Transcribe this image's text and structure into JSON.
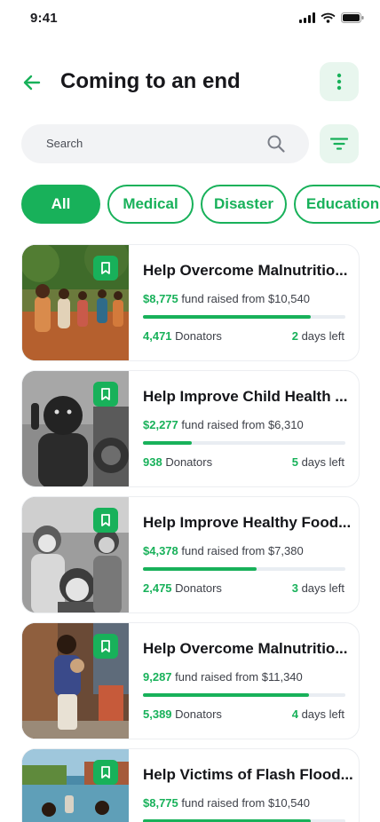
{
  "status": {
    "time": "9:41"
  },
  "header": {
    "title": "Coming to an end"
  },
  "search": {
    "placeholder": "Search"
  },
  "filters": [
    {
      "label": "All",
      "active": true
    },
    {
      "label": "Medical",
      "active": false
    },
    {
      "label": "Disaster",
      "active": false
    },
    {
      "label": "Education",
      "active": false
    }
  ],
  "campaigns": [
    {
      "title": "Help Overcome Malnutritio...",
      "raised": "$8,775",
      "raised_text": "fund raised from",
      "goal": "$10,540",
      "progress": 0.83,
      "donators": "4,471",
      "donators_label": "Donators",
      "days": "2",
      "days_label": "days left"
    },
    {
      "title": "Help Improve Child Health ...",
      "raised": "$2,277",
      "raised_text": "fund raised from",
      "goal": "$6,310",
      "progress": 0.24,
      "donators": "938",
      "donators_label": "Donators",
      "days": "5",
      "days_label": "days left"
    },
    {
      "title": "Help Improve Healthy Food...",
      "raised": "$4,378",
      "raised_text": "fund raised from",
      "goal": "$7,380",
      "progress": 0.56,
      "donators": "2,475",
      "donators_label": "Donators",
      "days": "3",
      "days_label": "days left"
    },
    {
      "title": "Help Overcome Malnutritio...",
      "raised": "9,287",
      "raised_text": "fund raised from",
      "goal": "$11,340",
      "progress": 0.82,
      "donators": "5,389",
      "donators_label": "Donators",
      "days": "4",
      "days_label": "days left"
    },
    {
      "title": "Help Victims of Flash Flood...",
      "raised": "$8,775",
      "raised_text": "fund raised from",
      "goal": "$10,540",
      "progress": 0.83,
      "donators": "",
      "donators_label": "",
      "days": "",
      "days_label": ""
    }
  ],
  "colors": {
    "accent": "#18b15a",
    "accent_soft": "#e8f6ee",
    "text": "#17171b"
  }
}
